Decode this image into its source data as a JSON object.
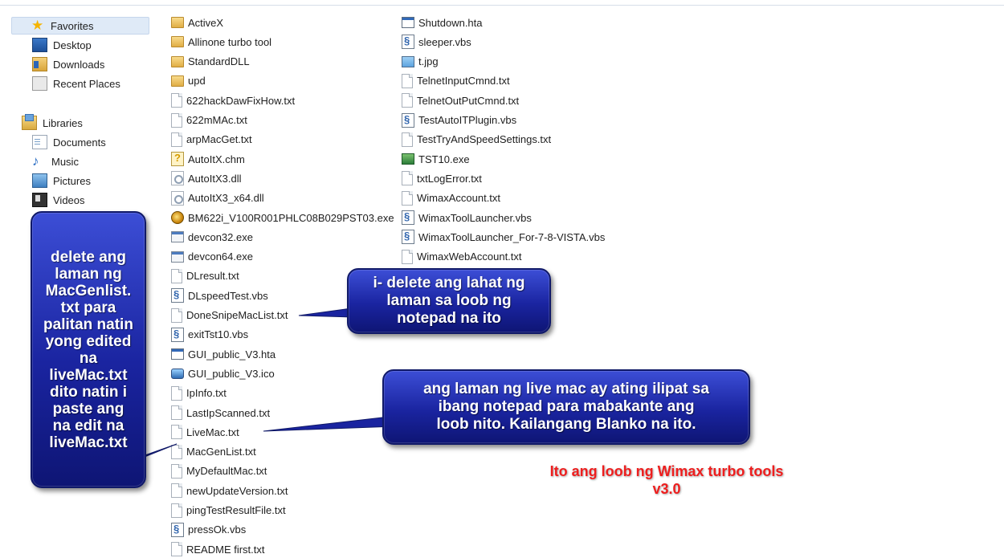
{
  "nav": {
    "favorites": "Favorites",
    "desktop": "Desktop",
    "downloads": "Downloads",
    "recent_places": "Recent Places",
    "libraries": "Libraries",
    "documents": "Documents",
    "music": "Music",
    "pictures": "Pictures",
    "videos": "Videos"
  },
  "files_col1": [
    {
      "name": "ActiveX",
      "icon": "folder-icon"
    },
    {
      "name": "Allinone turbo tool",
      "icon": "folder-icon"
    },
    {
      "name": "StandardDLL",
      "icon": "folder-icon"
    },
    {
      "name": "upd",
      "icon": "folder-icon"
    },
    {
      "name": "622hackDawFixHow.txt",
      "icon": "text-file-icon"
    },
    {
      "name": "622mMAc.txt",
      "icon": "text-file-icon"
    },
    {
      "name": "arpMacGet.txt",
      "icon": "text-file-icon"
    },
    {
      "name": "AutoItX.chm",
      "icon": "help-file-icon"
    },
    {
      "name": "AutoItX3.dll",
      "icon": "dll-file-icon"
    },
    {
      "name": "AutoItX3_x64.dll",
      "icon": "dll-file-icon"
    },
    {
      "name": "BM622i_V100R001PHLC08B029PST03.exe",
      "icon": "globe-exe-icon"
    },
    {
      "name": "devcon32.exe",
      "icon": "exe-file-icon"
    },
    {
      "name": "devcon64.exe",
      "icon": "exe-file-icon"
    },
    {
      "name": "DLresult.txt",
      "icon": "text-file-icon"
    },
    {
      "name": "DLspeedTest.vbs",
      "icon": "script-file-icon"
    },
    {
      "name": "DoneSnipeMacList.txt",
      "icon": "text-file-icon"
    },
    {
      "name": "exitTst10.vbs",
      "icon": "script-file-icon"
    },
    {
      "name": "GUI_public_V3.hta",
      "icon": "hta-file-icon"
    },
    {
      "name": "GUI_public_V3.ico",
      "icon": "ico-file-icon"
    },
    {
      "name": "IpInfo.txt",
      "icon": "text-file-icon"
    },
    {
      "name": "LastIpScanned.txt",
      "icon": "text-file-icon"
    },
    {
      "name": "LiveMac.txt",
      "icon": "text-file-icon"
    },
    {
      "name": "MacGenList.txt",
      "icon": "text-file-icon"
    },
    {
      "name": "MyDefaultMac.txt",
      "icon": "text-file-icon"
    },
    {
      "name": "newUpdateVersion.txt",
      "icon": "text-file-icon"
    },
    {
      "name": "pingTestResultFile.txt",
      "icon": "text-file-icon"
    },
    {
      "name": "pressOk.vbs",
      "icon": "script-file-icon"
    },
    {
      "name": "README first.txt",
      "icon": "text-file-icon"
    }
  ],
  "files_col2": [
    {
      "name": "Shutdown.hta",
      "icon": "hta-file-icon"
    },
    {
      "name": "sleeper.vbs",
      "icon": "script-file-icon"
    },
    {
      "name": "t.jpg",
      "icon": "image-file-icon"
    },
    {
      "name": "TelnetInputCmnd.txt",
      "icon": "text-file-icon"
    },
    {
      "name": "TelnetOutPutCmnd.txt",
      "icon": "text-file-icon"
    },
    {
      "name": "TestAutoITPlugin.vbs",
      "icon": "script-file-icon"
    },
    {
      "name": "TestTryAndSpeedSettings.txt",
      "icon": "text-file-icon"
    },
    {
      "name": "TST10.exe",
      "icon": "green-exe-icon"
    },
    {
      "name": "txtLogError.txt",
      "icon": "text-file-icon"
    },
    {
      "name": "WimaxAccount.txt",
      "icon": "text-file-icon"
    },
    {
      "name": "WimaxToolLauncher.vbs",
      "icon": "script-file-icon"
    },
    {
      "name": "WimaxToolLauncher_For-7-8-VISTA.vbs",
      "icon": "script-file-icon"
    },
    {
      "name": "WimaxWebAccount.txt",
      "icon": "text-file-icon"
    }
  ],
  "callouts": {
    "left": [
      "delete ang",
      "laman ng",
      "MacGenlist.",
      "txt para",
      "palitan natin",
      "yong edited",
      "na",
      "liveMac.txt",
      "dito natin i",
      "paste ang",
      "na edit na",
      "liveMac.txt"
    ],
    "middle": [
      "i- delete ang lahat ng",
      "laman sa loob ng",
      "notepad na ito"
    ],
    "right": [
      "ang laman ng live mac ay ating ilipat sa",
      "ibang notepad para mabakante ang",
      "loob nito. Kailangang Blanko na ito."
    ]
  },
  "red_note": [
    "Ito ang loob ng Wimax turbo tools",
    "v3.0"
  ],
  "colors": {
    "callout_blue": "#1a24a0",
    "note_red": "#ee1e1e",
    "favorites_highlight": "#dfeaf7"
  }
}
